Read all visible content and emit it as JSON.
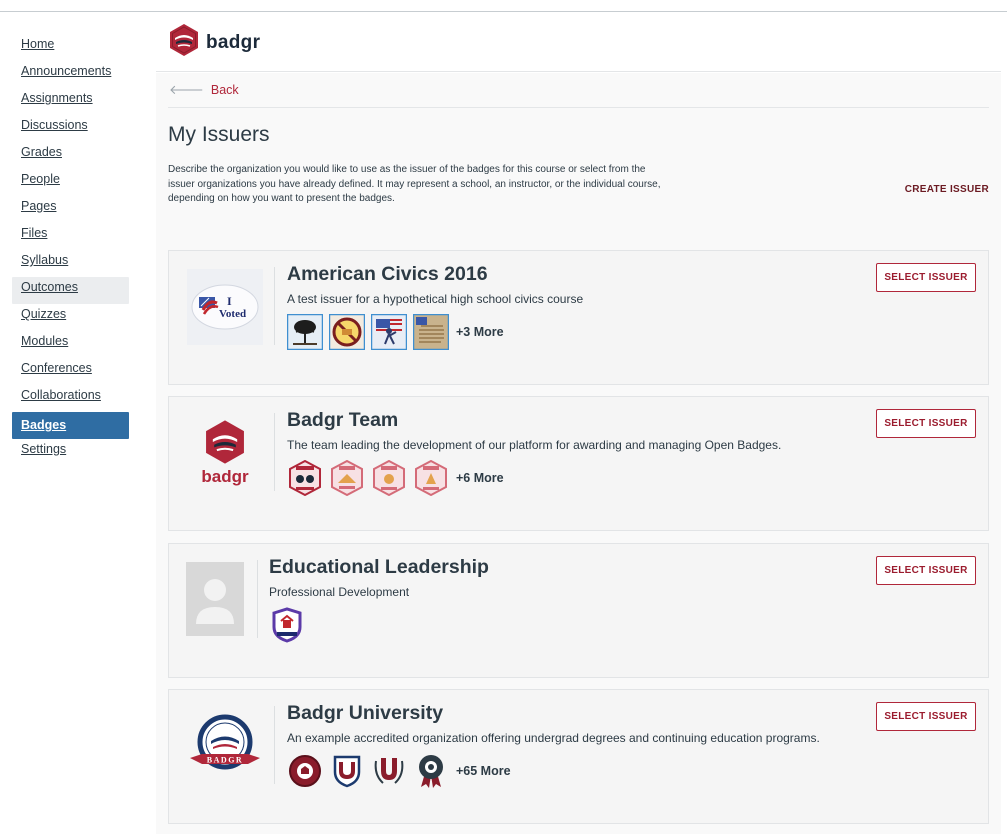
{
  "nav": {
    "items": [
      {
        "label": "Home"
      },
      {
        "label": "Announcements"
      },
      {
        "label": "Assignments"
      },
      {
        "label": "Discussions"
      },
      {
        "label": "Grades"
      },
      {
        "label": "People"
      },
      {
        "label": "Pages"
      },
      {
        "label": "Files"
      },
      {
        "label": "Syllabus"
      },
      {
        "label": "Outcomes"
      },
      {
        "label": "Quizzes"
      },
      {
        "label": "Modules"
      },
      {
        "label": "Conferences"
      },
      {
        "label": "Collaborations"
      },
      {
        "label": "Badges"
      },
      {
        "label": "Settings"
      }
    ],
    "active": "Badges",
    "faded": "Outcomes"
  },
  "app": {
    "brand": "badgr"
  },
  "page": {
    "back_label": "Back",
    "title": "My Issuers",
    "intro": "Describe the organization you would like to use as the issuer of the badges for this course or select from the issuer organizations you have already defined. It may represent a school, an instructor, or the individual course, depending on how you want to present the badges.",
    "create_issuer": "CREATE ISSUER"
  },
  "issuers": [
    {
      "name": "American Civics 2016",
      "description": "A test issuer for a hypothetical high school civics course",
      "logo": "i-voted-sticker",
      "badges": [
        "tree-badge",
        "no-symbol-badge",
        "patriot-figure-badge",
        "document-badge"
      ],
      "more": "+3 More",
      "select_label": "SELECT ISSUER"
    },
    {
      "name": "Badgr Team",
      "description": "The team leading the development of our platform for awarding and managing Open Badges.",
      "logo": "badgr-logo",
      "logo_text": "badgr",
      "badges": [
        "badgr-scout-badge",
        "badgr-badge-2",
        "badgr-badge-3",
        "badgr-badge-4"
      ],
      "more": "+6 More",
      "select_label": "SELECT ISSUER"
    },
    {
      "name": "Educational Leadership",
      "description": "Professional Development",
      "logo": "placeholder-avatar",
      "badges": [
        "classroom-shield-badge"
      ],
      "more": "",
      "select_label": "SELECT ISSUER"
    },
    {
      "name": "Badgr University",
      "description": "An example accredited organization offering undergrad degrees and continuing education programs.",
      "logo": "badgr-university-seal",
      "logo_text": "BADGR",
      "badges": [
        "university-seal-badge",
        "university-u-shield-badge",
        "university-u-wreath-badge",
        "university-ribbon-badge"
      ],
      "more": "+65 More",
      "select_label": "SELECT ISSUER"
    }
  ],
  "colors": {
    "accent": "#b0273a",
    "nav_active": "#2f6da3",
    "brand_dark": "#1c2a3a",
    "brand_red": "#b0273a"
  }
}
